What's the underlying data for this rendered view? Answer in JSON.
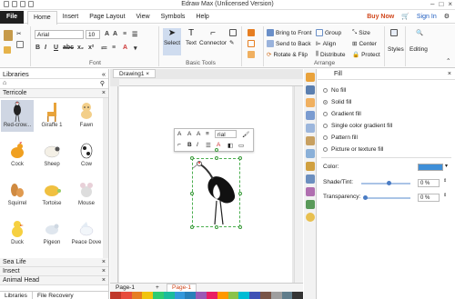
{
  "title": "Edraw Max (Unlicensed Version)",
  "menu": {
    "file": "File",
    "tabs": [
      "Home",
      "Insert",
      "Page Layout",
      "View",
      "Symbols",
      "Help"
    ],
    "buy_now": "Buy Now",
    "sign_in": "Sign In"
  },
  "ribbon": {
    "font_name": "Arial",
    "font_size": "10",
    "font_group": "Font",
    "select": "Select",
    "text": "Text",
    "connector": "Connector",
    "basic_tools": "Basic Tools",
    "bring_front": "Bring to Front",
    "send_back": "Send to Back",
    "rotate_flip": "Rotate & Flip",
    "group": "Group",
    "align": "Align",
    "distribute": "Distribute",
    "size": "Size",
    "center": "Center",
    "protect": "Protect",
    "arrange": "Arrange",
    "styles": "Styles",
    "editing": "Editing"
  },
  "libraries": {
    "title": "Libraries",
    "section": "Terricole",
    "shapes": [
      {
        "label": "Red-crow..."
      },
      {
        "label": "Giraffe 1"
      },
      {
        "label": "Fawn"
      },
      {
        "label": "Cock"
      },
      {
        "label": "Sheep"
      },
      {
        "label": "Cow"
      },
      {
        "label": "Squirrel"
      },
      {
        "label": "Tortoise"
      },
      {
        "label": "Mouse"
      },
      {
        "label": "Duck"
      },
      {
        "label": "Pigeon"
      },
      {
        "label": "Peace Dove"
      }
    ],
    "collapsed": [
      "Sea Life",
      "Insect",
      "Animal Head"
    ],
    "footer_tabs": [
      "Libraries",
      "File Recovery"
    ]
  },
  "document": {
    "tab": "Drawing1",
    "page_tab_left": "Page-1",
    "page_tab_active": "Page-1",
    "float_font": "rial"
  },
  "fill": {
    "title": "Fill",
    "options": [
      {
        "label": "No fill",
        "selected": false
      },
      {
        "label": "Solid fill",
        "selected": true
      },
      {
        "label": "Gradient fill",
        "selected": false
      },
      {
        "label": "Single color gradient fill",
        "selected": false
      },
      {
        "label": "Pattern fill",
        "selected": false
      },
      {
        "label": "Picture or texture fill",
        "selected": false
      }
    ],
    "color_label": "Color:",
    "color_value": "#3f8fd8",
    "shade_label": "Shade/Tint:",
    "shade_value": "0 %",
    "transparency_label": "Transparency:",
    "transparency_value": "0 %"
  },
  "colors": {
    "brand": "#d0461b",
    "accent": "#1d5bbf",
    "selection": "#4caf50"
  }
}
